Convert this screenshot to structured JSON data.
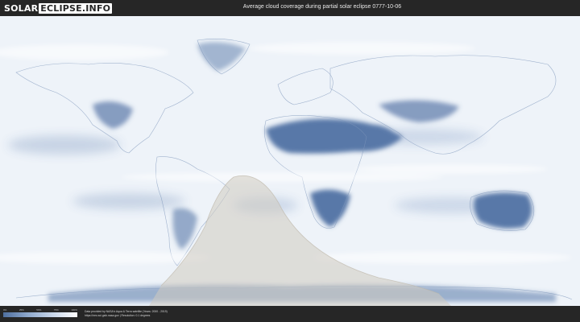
{
  "header": {
    "logo_part1": "SOLAR",
    "logo_part2": "ECLIPSE.INFO",
    "title": "Average cloud coverage during partial solar eclipse 0777-10-06"
  },
  "map": {
    "projection": "equirectangular world map",
    "layer": "average cloud coverage",
    "eclipse_zone": "partial eclipse visibility region (shaded)",
    "colors": {
      "clear_sky": "#4f6f9f",
      "partial": "#9fb5d5",
      "cloudy": "#ffffff",
      "eclipse_overlay": "#cfcac0",
      "background_bar": "#262626"
    }
  },
  "legend": {
    "ticks": [
      "0%",
      "25%",
      "50%",
      "75%",
      "100%"
    ]
  },
  "footer": {
    "credit_line1": "Data provided by NASA's Aqua & Terra satellite (Years: 2000 - 2019)",
    "credit_line2": "https://neo.sci.gsfc.nasa.gov | Resolution: 0.1 degrees"
  }
}
